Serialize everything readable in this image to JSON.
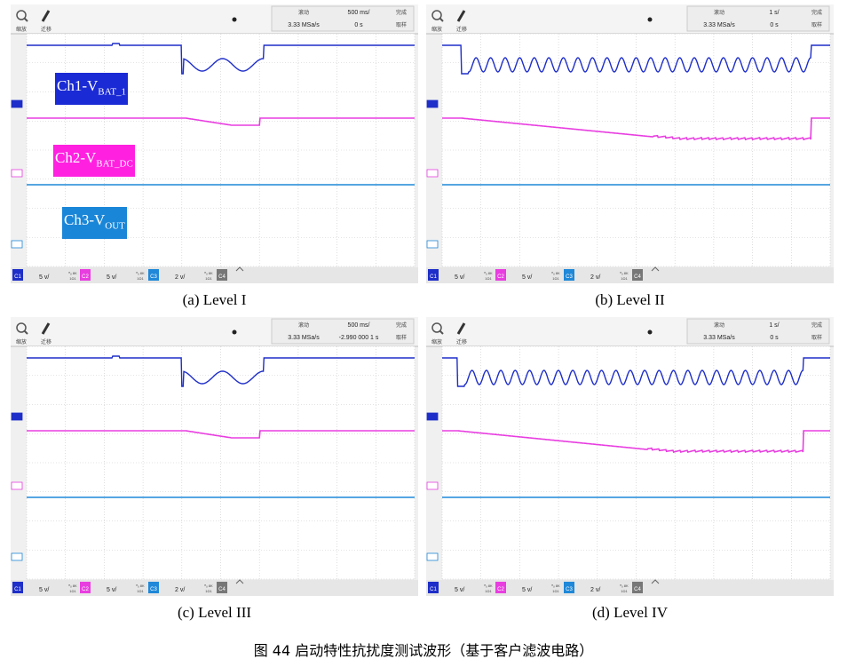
{
  "figure_caption": "图 44 启动特性抗扰度测试波形（基于客户滤波电路）",
  "channel_labels": {
    "ch1": {
      "main": "Ch1-V",
      "sub": "BAT_1",
      "color": "#1a2ad4"
    },
    "ch2": {
      "main": "Ch2-V",
      "sub": "BAT_DC",
      "color": "#ff20e0"
    },
    "ch3": {
      "main": "Ch3-V",
      "sub": "OUT",
      "color": "#1a86d8"
    }
  },
  "colors": {
    "ch1": "#1e2ec8",
    "ch2": "#e83ee0",
    "ch3": "#1f88d8",
    "grid": "#c8c8c8",
    "screen_bg": "#ffffff",
    "frame_bg": "#f0f0f0"
  },
  "toolbar": {
    "zoom_label": "缩放",
    "migrate_label": "迁移",
    "trigger_label": "滚动",
    "done_label": "完成",
    "sample_label": "取样"
  },
  "channel_chips": [
    "C1",
    "C2",
    "C3",
    "C4"
  ],
  "channel_scales": [
    "5 v/",
    "5 v/",
    "2 v/"
  ],
  "chip_sub": "ᴴᵤ 8K",
  "chip_sub2": "1Ω1",
  "panels": [
    {
      "caption": "(a) Level I",
      "timebase": "500 ms/",
      "sample_rate": "3.33 MSa/s",
      "offset": "0 s",
      "show_labels": true
    },
    {
      "caption": "(b) Level II",
      "timebase": "1 s/",
      "sample_rate": "3.33 MSa/s",
      "offset": "0 s",
      "show_labels": false
    },
    {
      "caption": "(c) Level III",
      "timebase": "500 ms/",
      "sample_rate": "3.33 MSa/s",
      "offset": "-2.990 000 1 s",
      "show_labels": false
    },
    {
      "caption": "(d) Level IV",
      "timebase": "1 s/",
      "sample_rate": "3.33 MSa/s",
      "offset": "0 s",
      "show_labels": false
    }
  ],
  "chart_data": [
    {
      "type": "line",
      "title": "(a) Level I",
      "x_unit": "s",
      "x_per_div": 0.5,
      "series": [
        {
          "name": "Ch1-V_BAT_1",
          "shape": "dip_sine",
          "dip_start_frac": 0.4,
          "dip_end_frac": 0.61,
          "cycles": 2
        },
        {
          "name": "Ch2-V_BAT_DC",
          "shape": "slow_sag",
          "sag_start_frac": 0.41,
          "sag_end_frac": 0.6
        },
        {
          "name": "Ch3-V_OUT",
          "shape": "flat"
        }
      ]
    },
    {
      "type": "line",
      "title": "(b) Level II",
      "x_unit": "s",
      "x_per_div": 1,
      "series": [
        {
          "name": "Ch1-V_BAT_1",
          "shape": "dip_sine",
          "dip_start_frac": 0.05,
          "dip_end_frac": 0.95,
          "cycles": 24
        },
        {
          "name": "Ch2-V_BAT_DC",
          "shape": "slow_sag",
          "sag_start_frac": 0.05,
          "sag_end_frac": 0.95
        },
        {
          "name": "Ch3-V_OUT",
          "shape": "flat"
        }
      ]
    },
    {
      "type": "line",
      "title": "(c) Level III",
      "x_unit": "s",
      "x_per_div": 0.5,
      "series": [
        {
          "name": "Ch1-V_BAT_1",
          "shape": "dip_sine",
          "dip_start_frac": 0.4,
          "dip_end_frac": 0.61,
          "cycles": 2
        },
        {
          "name": "Ch2-V_BAT_DC",
          "shape": "slow_sag",
          "sag_start_frac": 0.41,
          "sag_end_frac": 0.6
        },
        {
          "name": "Ch3-V_OUT",
          "shape": "flat"
        }
      ]
    },
    {
      "type": "line",
      "title": "(d) Level IV",
      "x_unit": "s",
      "x_per_div": 1,
      "series": [
        {
          "name": "Ch1-V_BAT_1",
          "shape": "dip_sine",
          "dip_start_frac": 0.04,
          "dip_end_frac": 0.93,
          "cycles": 24
        },
        {
          "name": "Ch2-V_BAT_DC",
          "shape": "slow_sag",
          "sag_start_frac": 0.04,
          "sag_end_frac": 0.93
        },
        {
          "name": "Ch3-V_OUT",
          "shape": "flat"
        }
      ]
    }
  ]
}
